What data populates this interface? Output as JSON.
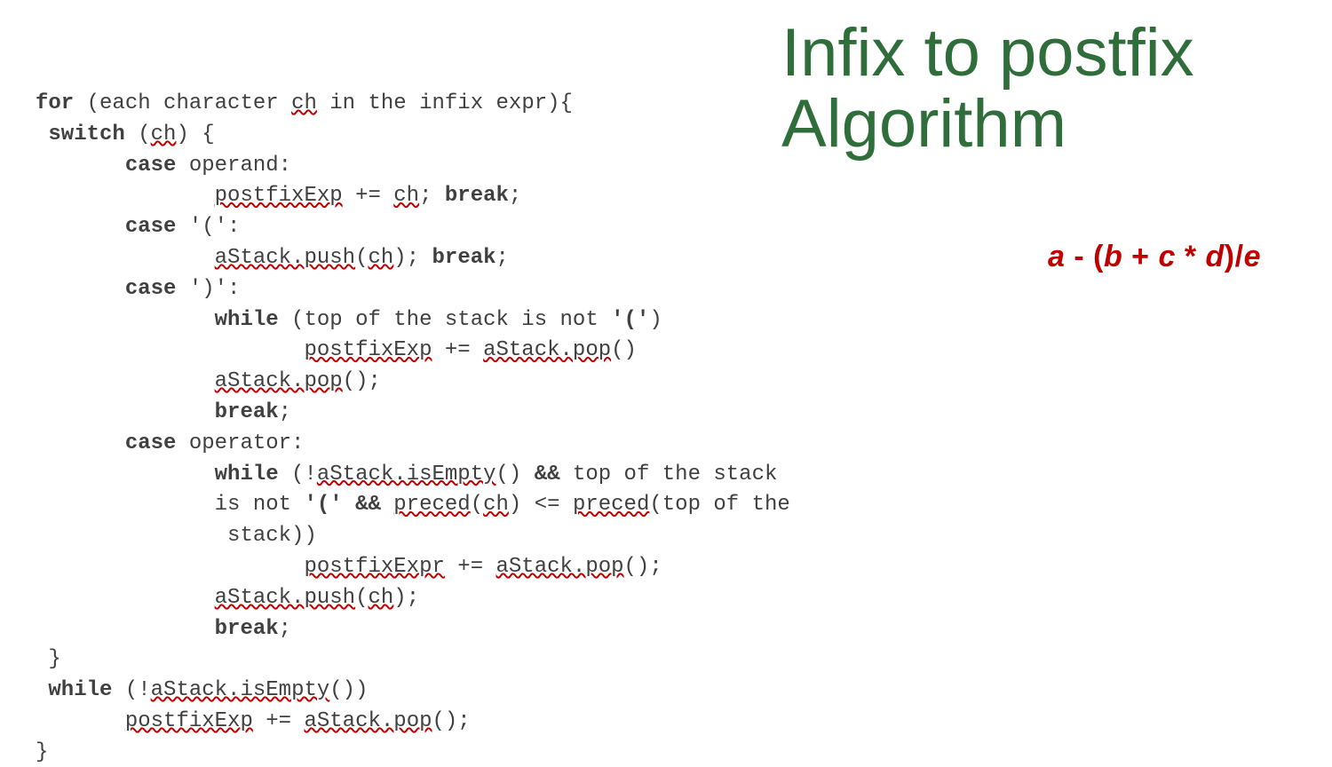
{
  "title": {
    "line1": "Infix to postfix",
    "line2": "Algorithm"
  },
  "example_expression": {
    "a": "a",
    "minus": " - ",
    "lp": "(",
    "b": "b",
    "plus": " + ",
    "c": "c",
    "times": " * ",
    "d": "d",
    "rp": ")",
    "div": "/",
    "e": "e"
  },
  "code": {
    "kw_for": "for",
    "l1_a": " (each character ",
    "l1_ch": "ch",
    "l1_b": " in the infix expr){",
    "kw_switch": " switch",
    "l2_a": " (",
    "l2_ch": "ch",
    "l2_b": ") {",
    "kw_case1": "       case",
    "l3_a": " operand:",
    "l4_pf": "postfixExp",
    "l4_a": " += ",
    "l4_ch": "ch",
    "l4_b": "; ",
    "kw_break": "break",
    "semi": ";",
    "kw_case2": "       case",
    "l5_a": " '(':",
    "l6_push": "aStack.push",
    "l6_a": "(",
    "l6_ch": "ch",
    "l6_b": "); ",
    "kw_case3": "       case",
    "l7_a": " ')':",
    "kw_while1": "while",
    "l8_a": " (top of the stack is not ",
    "l8_b": "'('",
    "l8_c": ")",
    "l9_pf": "postfixExp",
    "l9_a": " += ",
    "l9_pop": "aStack.pop",
    "l9_b": "()",
    "l10_pop": "aStack.pop",
    "l10_a": "();",
    "kw_case4": "       case",
    "l12_a": " operator:",
    "kw_while2": "while",
    "l13_a": " (!",
    "l13_ie": "aStack.isEmpty",
    "l13_b": "() ",
    "kw_and": "&&",
    "l13_c": " top of the stack",
    "l14_a": "              is not ",
    "l14_b": "'(' ",
    "l14_c": " ",
    "l14_pr1": "preced",
    "l14_d": "(",
    "l14_ch": "ch",
    "l14_e": ") <= ",
    "l14_pr2": "preced",
    "l14_f": "(top of the",
    "l15_a": "               stack))",
    "l16_pf": "postfixExpr",
    "l16_a": " += ",
    "l16_pop": "aStack.pop",
    "l16_b": "();",
    "l17_push": "aStack.push",
    "l17_a": "(",
    "l17_ch": "ch",
    "l17_b": ");",
    "l19_a": " }",
    "kw_while3": " while",
    "l20_a": " (!",
    "l20_ie": "aStack.isEmpty",
    "l20_b": "())",
    "l21_pf": "postfixExp",
    "l21_a": " += ",
    "l21_pop": "aStack.pop",
    "l21_b": "();",
    "l22_a": "}"
  }
}
